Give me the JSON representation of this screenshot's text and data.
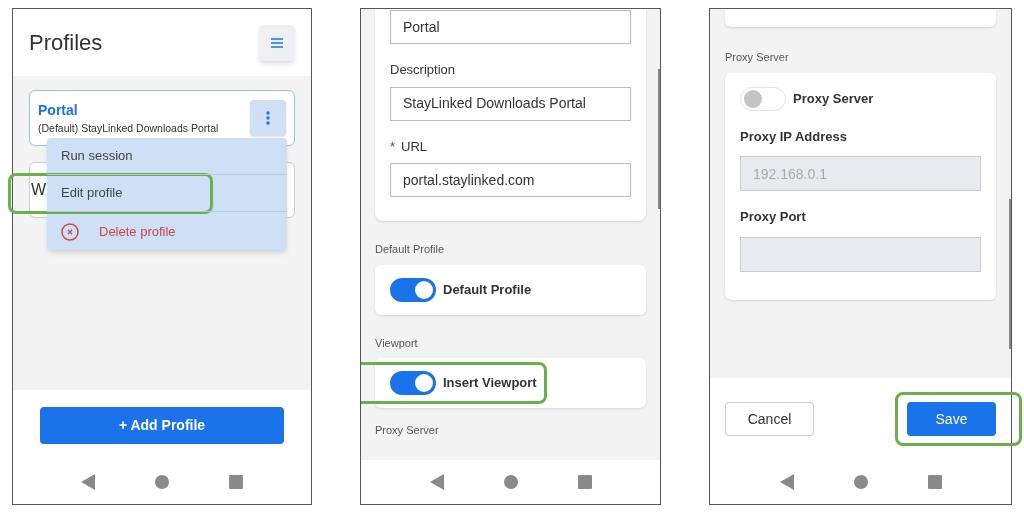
{
  "screens": [
    {
      "kind": "list",
      "title": "Profiles",
      "profiles": [
        {
          "name": "Portal",
          "description": "(Default) StayLinked Downloads Portal"
        },
        {
          "name": "W"
        }
      ],
      "menu": {
        "items": [
          {
            "kind": "plain",
            "label": "Run session",
            "highlighted": false
          },
          {
            "kind": "plain",
            "label": "Edit profile",
            "highlighted": true
          },
          {
            "kind": "danger",
            "label": "Delete profile",
            "highlighted": false
          }
        ]
      },
      "add_button": "+ Add Profile"
    },
    {
      "kind": "form",
      "fields": [
        {
          "value": "Portal"
        },
        {
          "label": "Description",
          "value": "StayLinked Downloads Portal"
        },
        {
          "label": "URL",
          "marker": "*",
          "value": "portal.staylinked.com"
        }
      ],
      "sections": [
        {
          "heading": "Default Profile",
          "toggle": {
            "label": "Default Profile",
            "on": true,
            "highlighted": false
          }
        },
        {
          "heading": "Viewport",
          "toggle": {
            "label": "Insert Viewport",
            "on": true,
            "highlighted": true
          }
        }
      ],
      "next_heading": "Proxy Server"
    },
    {
      "kind": "proxy",
      "heading": "Proxy Server",
      "toggle": {
        "label": "Proxy Server",
        "on": false
      },
      "fields": [
        {
          "label": "Proxy IP Address",
          "placeholder": "192.168.0.1",
          "disabled": true
        },
        {
          "label": "Proxy Port",
          "disabled": true
        }
      ],
      "buttons": [
        {
          "label": "Cancel",
          "primary": false,
          "highlighted": false
        },
        {
          "label": "Save",
          "primary": true,
          "highlighted": true
        }
      ]
    }
  ]
}
